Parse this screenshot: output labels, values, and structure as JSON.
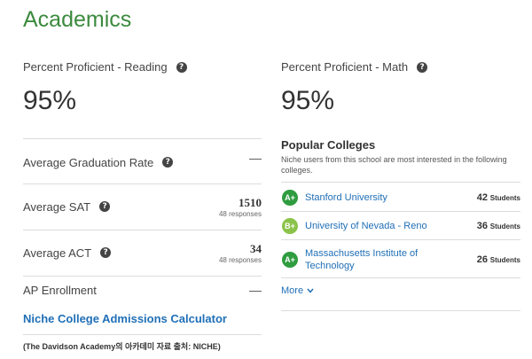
{
  "section_title": "Academics",
  "reading": {
    "label": "Percent Proficient - Reading",
    "value": "95%"
  },
  "math": {
    "label": "Percent Proficient - Math",
    "value": "95%"
  },
  "help_icon_glyph": "?",
  "stats": {
    "graduation": {
      "label": "Average Graduation Rate",
      "value": "—"
    },
    "sat": {
      "label": "Average SAT",
      "value": "1510",
      "sub": "48 responses"
    },
    "act": {
      "label": "Average ACT",
      "value": "34",
      "sub": "48 responses"
    },
    "ap": {
      "label": "AP Enrollment",
      "value": "—"
    }
  },
  "calculator_link": "Niche College Admissions Calculator",
  "popular": {
    "title": "Popular Colleges",
    "description": "Niche users from this school are most interested in the following colleges.",
    "colleges": [
      {
        "grade": "A+",
        "grade_color": "#2e9c3f",
        "name": "Stanford University",
        "count": "42",
        "unit": "Students"
      },
      {
        "grade": "B+",
        "grade_color": "#8bc34a",
        "name": "University of Nevada - Reno",
        "count": "36",
        "unit": "Students"
      },
      {
        "grade": "A+",
        "grade_color": "#2e9c3f",
        "name": "Massachusetts Institute of Technology",
        "count": "26",
        "unit": "Students"
      }
    ],
    "more_label": "More"
  },
  "caption": "(The Davidson Academy의 아카데미 자료 출처: NICHE)",
  "colors": {
    "title_green": "#3c8a3e",
    "link_blue": "#1f6fb6",
    "divider": "#dcdcdc"
  }
}
